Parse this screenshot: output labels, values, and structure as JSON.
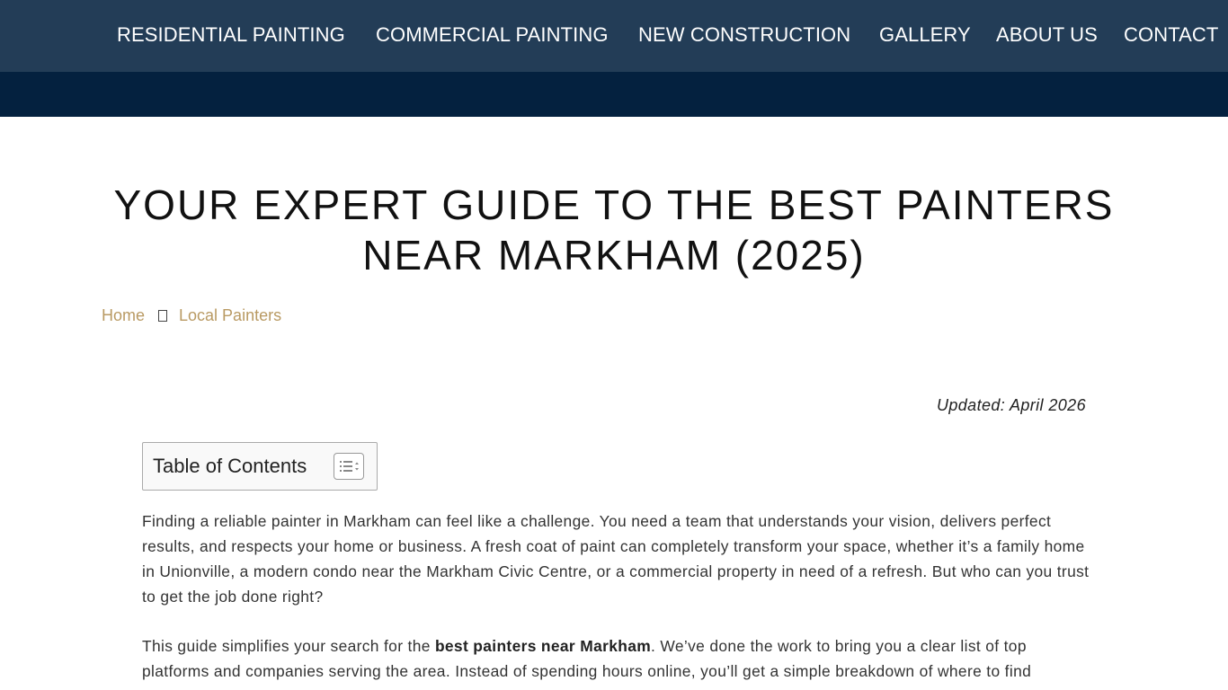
{
  "nav": {
    "items": [
      {
        "label": "RESIDENTIAL PAINTING"
      },
      {
        "label": "COMMERCIAL PAINTING"
      },
      {
        "label": "NEW CONSTRUCTION"
      },
      {
        "label": "GALLERY"
      },
      {
        "label": "ABOUT US"
      },
      {
        "label": "CONTACT"
      }
    ]
  },
  "page": {
    "title_line1": "YOUR EXPERT GUIDE TO THE BEST PAINTERS",
    "title_line2": "NEAR MARKHAM (2025)",
    "breadcrumb": {
      "home": "Home",
      "current": "Local Painters"
    },
    "updated": "Updated: April 2026"
  },
  "toc": {
    "title": "Table of Contents",
    "toggle_icon": "list-toggle-icon"
  },
  "content": {
    "p1": "Finding a reliable painter in Markham can feel like a challenge. You need a team that understands your vision, delivers perfect results, and respects your home or business. A fresh coat of paint can completely transform your space, whether it’s a family home in Unionville, a modern condo near the Markham Civic Centre, or a commercial property in need of a refresh. But who can you trust to get the job done right?",
    "p2_before": "This guide simplifies your search for the ",
    "p2_bold": "best painters near Markham",
    "p2_after": ". We’ve done the work to bring you a clear list of top platforms and companies serving the area. Instead of spending hours online, you’ll get a simple breakdown of where to find"
  },
  "colors": {
    "nav_bg": "#233d57",
    "subbar_bg": "#04213f",
    "breadcrumb_link": "#b99a63"
  }
}
